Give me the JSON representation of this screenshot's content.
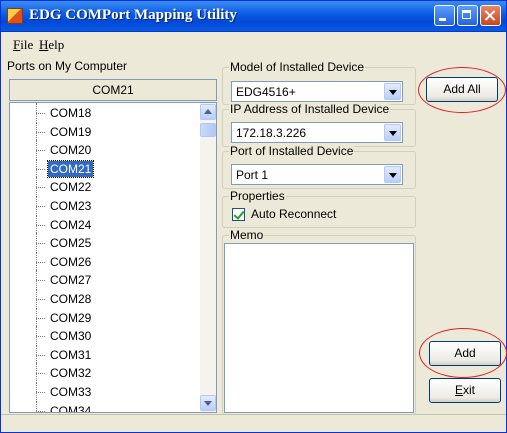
{
  "window": {
    "title": "EDG COMPort Mapping Utility",
    "app_icon": "plug-icon"
  },
  "menu": {
    "items": [
      {
        "label": "File"
      },
      {
        "label": "Help"
      }
    ]
  },
  "ports": {
    "group_label": "Ports on My Computer",
    "header": "COM21",
    "items": [
      {
        "label": "COM18",
        "selected": false
      },
      {
        "label": "COM19",
        "selected": false
      },
      {
        "label": "COM20",
        "selected": false
      },
      {
        "label": "COM21",
        "selected": true
      },
      {
        "label": "COM22",
        "selected": false
      },
      {
        "label": "COM23",
        "selected": false
      },
      {
        "label": "COM24",
        "selected": false
      },
      {
        "label": "COM25",
        "selected": false
      },
      {
        "label": "COM26",
        "selected": false
      },
      {
        "label": "COM27",
        "selected": false
      },
      {
        "label": "COM28",
        "selected": false
      },
      {
        "label": "COM29",
        "selected": false
      },
      {
        "label": "COM30",
        "selected": false
      },
      {
        "label": "COM31",
        "selected": false
      },
      {
        "label": "COM32",
        "selected": false
      },
      {
        "label": "COM33",
        "selected": false
      },
      {
        "label": "COM34",
        "selected": false
      }
    ]
  },
  "device": {
    "model_label": "Model of Installed Device",
    "model_value": "EDG4516+",
    "ip_label": "IP Address of Installed Device",
    "ip_value": "172.18.3.226",
    "port_label": "Port of Installed Device",
    "port_value": "Port 1"
  },
  "properties": {
    "group_label": "Properties",
    "auto_reconnect_label": "Auto Reconnect",
    "auto_reconnect_checked": true
  },
  "memo": {
    "group_label": "Memo",
    "text": ""
  },
  "buttons": {
    "add_all": "Add All",
    "add": "Add",
    "exit": "Exit"
  },
  "colors": {
    "title_bar": "#0a5ae6",
    "selection": "#316ac5",
    "highlight_ring": "#e0202a"
  }
}
